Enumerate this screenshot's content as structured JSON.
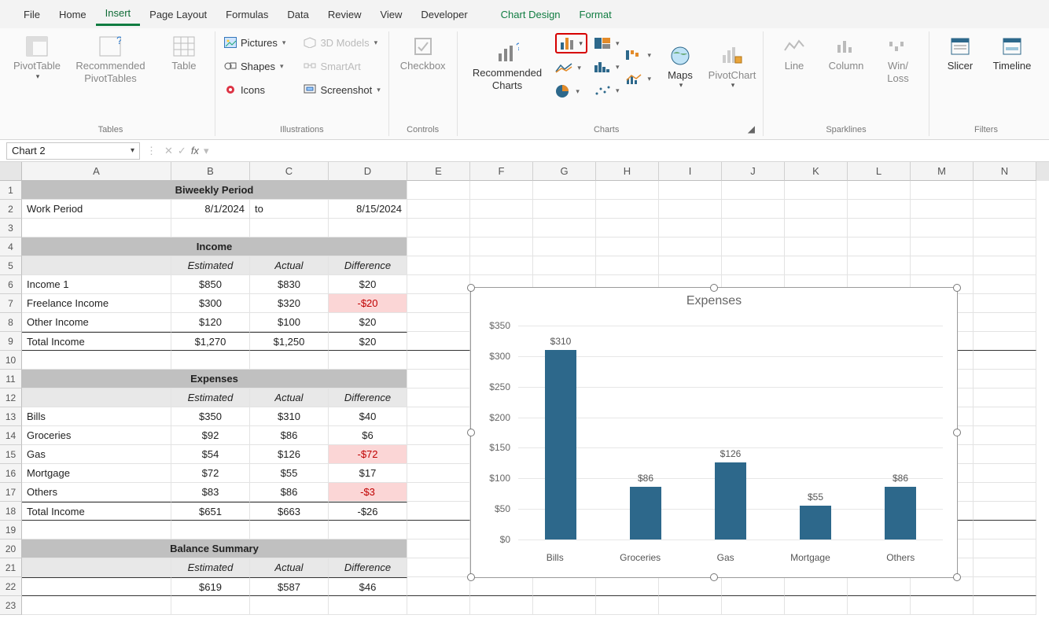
{
  "ribbon": {
    "tabs": [
      "File",
      "Home",
      "Insert",
      "Page Layout",
      "Formulas",
      "Data",
      "Review",
      "View",
      "Developer"
    ],
    "context_tabs": [
      "Chart Design",
      "Format"
    ],
    "active_tab": "Insert",
    "groups": {
      "tables": {
        "label": "Tables",
        "pivot": "PivotTable",
        "rec": "Recommended PivotTables",
        "table": "Table"
      },
      "illustrations": {
        "label": "Illustrations",
        "pictures": "Pictures",
        "shapes": "Shapes",
        "icons": "Icons",
        "models": "3D Models",
        "smartart": "SmartArt",
        "screenshot": "Screenshot"
      },
      "controls": {
        "label": "Controls",
        "checkbox": "Checkbox"
      },
      "charts": {
        "label": "Charts",
        "rec": "Recommended Charts",
        "maps": "Maps",
        "pivotchart": "PivotChart"
      },
      "sparklines": {
        "label": "Sparklines",
        "line": "Line",
        "column": "Column",
        "winloss": "Win/ Loss"
      },
      "filters": {
        "label": "Filters",
        "slicer": "Slicer",
        "timeline": "Timeline"
      }
    }
  },
  "namebox": "Chart 2",
  "columns": [
    "A",
    "B",
    "C",
    "D",
    "E",
    "F",
    "G",
    "H",
    "I",
    "J",
    "K",
    "L",
    "M",
    "N"
  ],
  "rowcount": 23,
  "sheet": {
    "title": "Biweekly Period",
    "work_period_label": "Work Period",
    "date_from": "8/1/2024",
    "to": "to",
    "date_to": "8/15/2024",
    "income_hdr": "Income",
    "est": "Estimated",
    "act": "Actual",
    "diff": "Difference",
    "income": [
      {
        "name": "Income 1",
        "est": "$850",
        "act": "$830",
        "diff": "$20"
      },
      {
        "name": "Freelance Income",
        "est": "$300",
        "act": "$320",
        "diff": "-$20",
        "neg": true
      },
      {
        "name": "Other Income",
        "est": "$120",
        "act": "$100",
        "diff": "$20"
      }
    ],
    "income_total": {
      "name": "Total Income",
      "est": "$1,270",
      "act": "$1,250",
      "diff": "$20"
    },
    "expenses_hdr": "Expenses",
    "expenses": [
      {
        "name": "Bills",
        "est": "$350",
        "act": "$310",
        "diff": "$40"
      },
      {
        "name": "Groceries",
        "est": "$92",
        "act": "$86",
        "diff": "$6"
      },
      {
        "name": "Gas",
        "est": "$54",
        "act": "$126",
        "diff": "-$72",
        "neg": true
      },
      {
        "name": "Mortgage",
        "est": "$72",
        "act": "$55",
        "diff": "$17"
      },
      {
        "name": "Others",
        "est": "$83",
        "act": "$86",
        "diff": "-$3",
        "neg": true
      }
    ],
    "expenses_total": {
      "name": "Total Income",
      "est": "$651",
      "act": "$663",
      "diff": "-$26"
    },
    "balance_hdr": "Balance Summary",
    "balance": {
      "est": "$619",
      "act": "$587",
      "diff": "$46"
    }
  },
  "chart_data": {
    "type": "bar",
    "title": "Expenses",
    "categories": [
      "Bills",
      "Groceries",
      "Gas",
      "Mortgage",
      "Others"
    ],
    "values": [
      310,
      86,
      126,
      55,
      86
    ],
    "value_labels": [
      "$310",
      "$86",
      "$126",
      "$55",
      "$86"
    ],
    "ylim": [
      0,
      350
    ],
    "yticks": [
      "$0",
      "$50",
      "$100",
      "$150",
      "$200",
      "$250",
      "$300",
      "$350"
    ]
  }
}
